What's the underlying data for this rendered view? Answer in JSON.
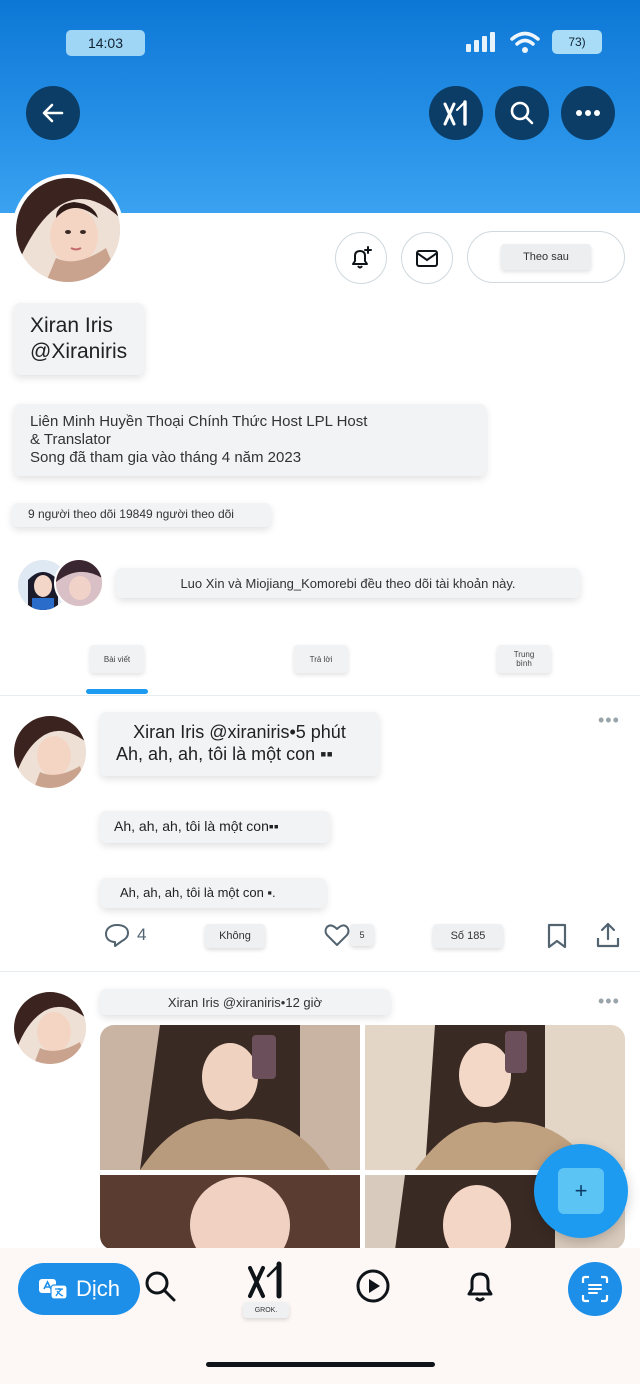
{
  "status": {
    "time": "14:03",
    "battery": "73)"
  },
  "profile": {
    "name": "Xiran Iris",
    "handle": "@Xiraniris",
    "follow_label": "Theo sau",
    "bio_line1": "Liên Minh Huyền Thoại Chính Thức Host LPL Host",
    "bio_line2": "& Translator",
    "joined": "Song đã tham gia vào tháng 4 năm 2023",
    "stats": "9 người theo dõi 19849 người theo dõi",
    "followed_by": "Luo Xin và Miojiang_Komorebi đều theo dõi tài khoản này."
  },
  "tabs": [
    {
      "label": "Bài viết"
    },
    {
      "label": "Trả lời"
    },
    {
      "label": "Trung bình"
    }
  ],
  "posts": [
    {
      "header": "Xiran Iris @xiraniris•5 phút",
      "line1": "Ah, ah, ah, tôi là một con ▪▪",
      "line2": "Ah, ah, ah, tôi là một con▪▪",
      "line3": "Ah, ah, ah, tôi là một con ▪.",
      "replies": "4",
      "reposts": "Không",
      "likes": "5",
      "views": "Số 185"
    },
    {
      "header": "Xiran Iris @xiraniris•12 giờ"
    }
  ],
  "fab_label": "+",
  "bottom": {
    "translate_label": "Dịch",
    "grok_label": "GROK."
  },
  "colors": {
    "accent": "#1d9bf0",
    "header_top": "#0d77d6",
    "header_btn": "#0b3d66"
  }
}
